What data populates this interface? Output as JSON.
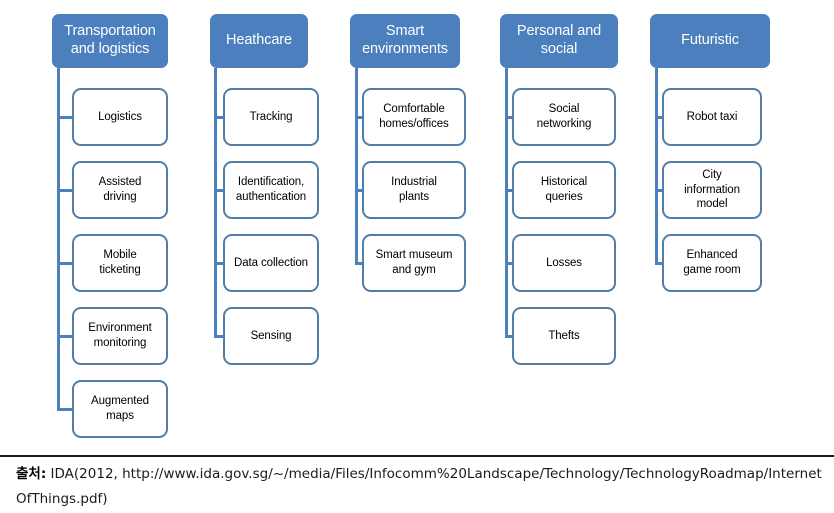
{
  "diagram": {
    "title_semantics": "iot-application-domains",
    "colors": {
      "header_fill": "#4b7fbd",
      "header_text": "#ffffff",
      "node_border": "#517ea6",
      "node_fill": "#ffffff",
      "node_text": "#000000",
      "connector": "#4b7fbd",
      "rule": "#1a1a1a"
    },
    "columns": [
      {
        "id": "transportation-and-logistics",
        "header": "Transportation and logistics",
        "header_lines": [
          "Transportation",
          "and logistics"
        ],
        "items": [
          {
            "label": "Logistics",
            "lines": [
              "Logistics"
            ]
          },
          {
            "label": "Assisted driving",
            "lines": [
              "Assisted",
              "driving"
            ]
          },
          {
            "label": "Mobile ticketing",
            "lines": [
              "Mobile",
              "ticketing"
            ]
          },
          {
            "label": "Environment monitoring",
            "lines": [
              "Environment",
              "monitoring"
            ]
          },
          {
            "label": "Augmented maps",
            "lines": [
              "Augmented",
              "maps"
            ]
          }
        ]
      },
      {
        "id": "heathcare",
        "header": "Heathcare",
        "header_lines": [
          "Heathcare"
        ],
        "items": [
          {
            "label": "Tracking",
            "lines": [
              "Tracking"
            ]
          },
          {
            "label": "Identification, authentication",
            "lines": [
              "Identification,",
              "authentication"
            ]
          },
          {
            "label": "Data collection",
            "lines": [
              "Data collection"
            ]
          },
          {
            "label": "Sensing",
            "lines": [
              "Sensing"
            ]
          }
        ]
      },
      {
        "id": "smart-environments",
        "header": "Smart environments",
        "header_lines": [
          "Smart",
          "environments"
        ],
        "items": [
          {
            "label": "Comfortable homes/offices",
            "lines": [
              "Comfortable",
              "homes/offices"
            ]
          },
          {
            "label": "Industrial plants",
            "lines": [
              "Industrial",
              "plants"
            ]
          },
          {
            "label": "Smart museum and gym",
            "lines": [
              "Smart museum",
              "and gym"
            ]
          }
        ]
      },
      {
        "id": "personal-and-social",
        "header": "Personal and social",
        "header_lines": [
          "Personal and",
          "social"
        ],
        "items": [
          {
            "label": "Social networking",
            "lines": [
              "Social",
              "networking"
            ]
          },
          {
            "label": "Historical queries",
            "lines": [
              "Historical",
              "queries"
            ]
          },
          {
            "label": "Losses",
            "lines": [
              "Losses"
            ]
          },
          {
            "label": "Thefts",
            "lines": [
              "Thefts"
            ]
          }
        ]
      },
      {
        "id": "futuristic",
        "header": "Futuristic",
        "header_lines": [
          "Futuristic"
        ],
        "items": [
          {
            "label": "Robot taxi",
            "lines": [
              "Robot taxi"
            ]
          },
          {
            "label": "City information model",
            "lines": [
              "City",
              "information",
              "model"
            ]
          },
          {
            "label": "Enhanced game room",
            "lines": [
              "Enhanced",
              "game room"
            ]
          }
        ]
      }
    ]
  },
  "caption": {
    "label": "출처:",
    "body": " IDA(2012, http://www.ida.gov.sg/~/media/Files/Infocomm%20Landscape/Technology/TechnologyRoadmap/InternetOfThings.pdf)"
  }
}
